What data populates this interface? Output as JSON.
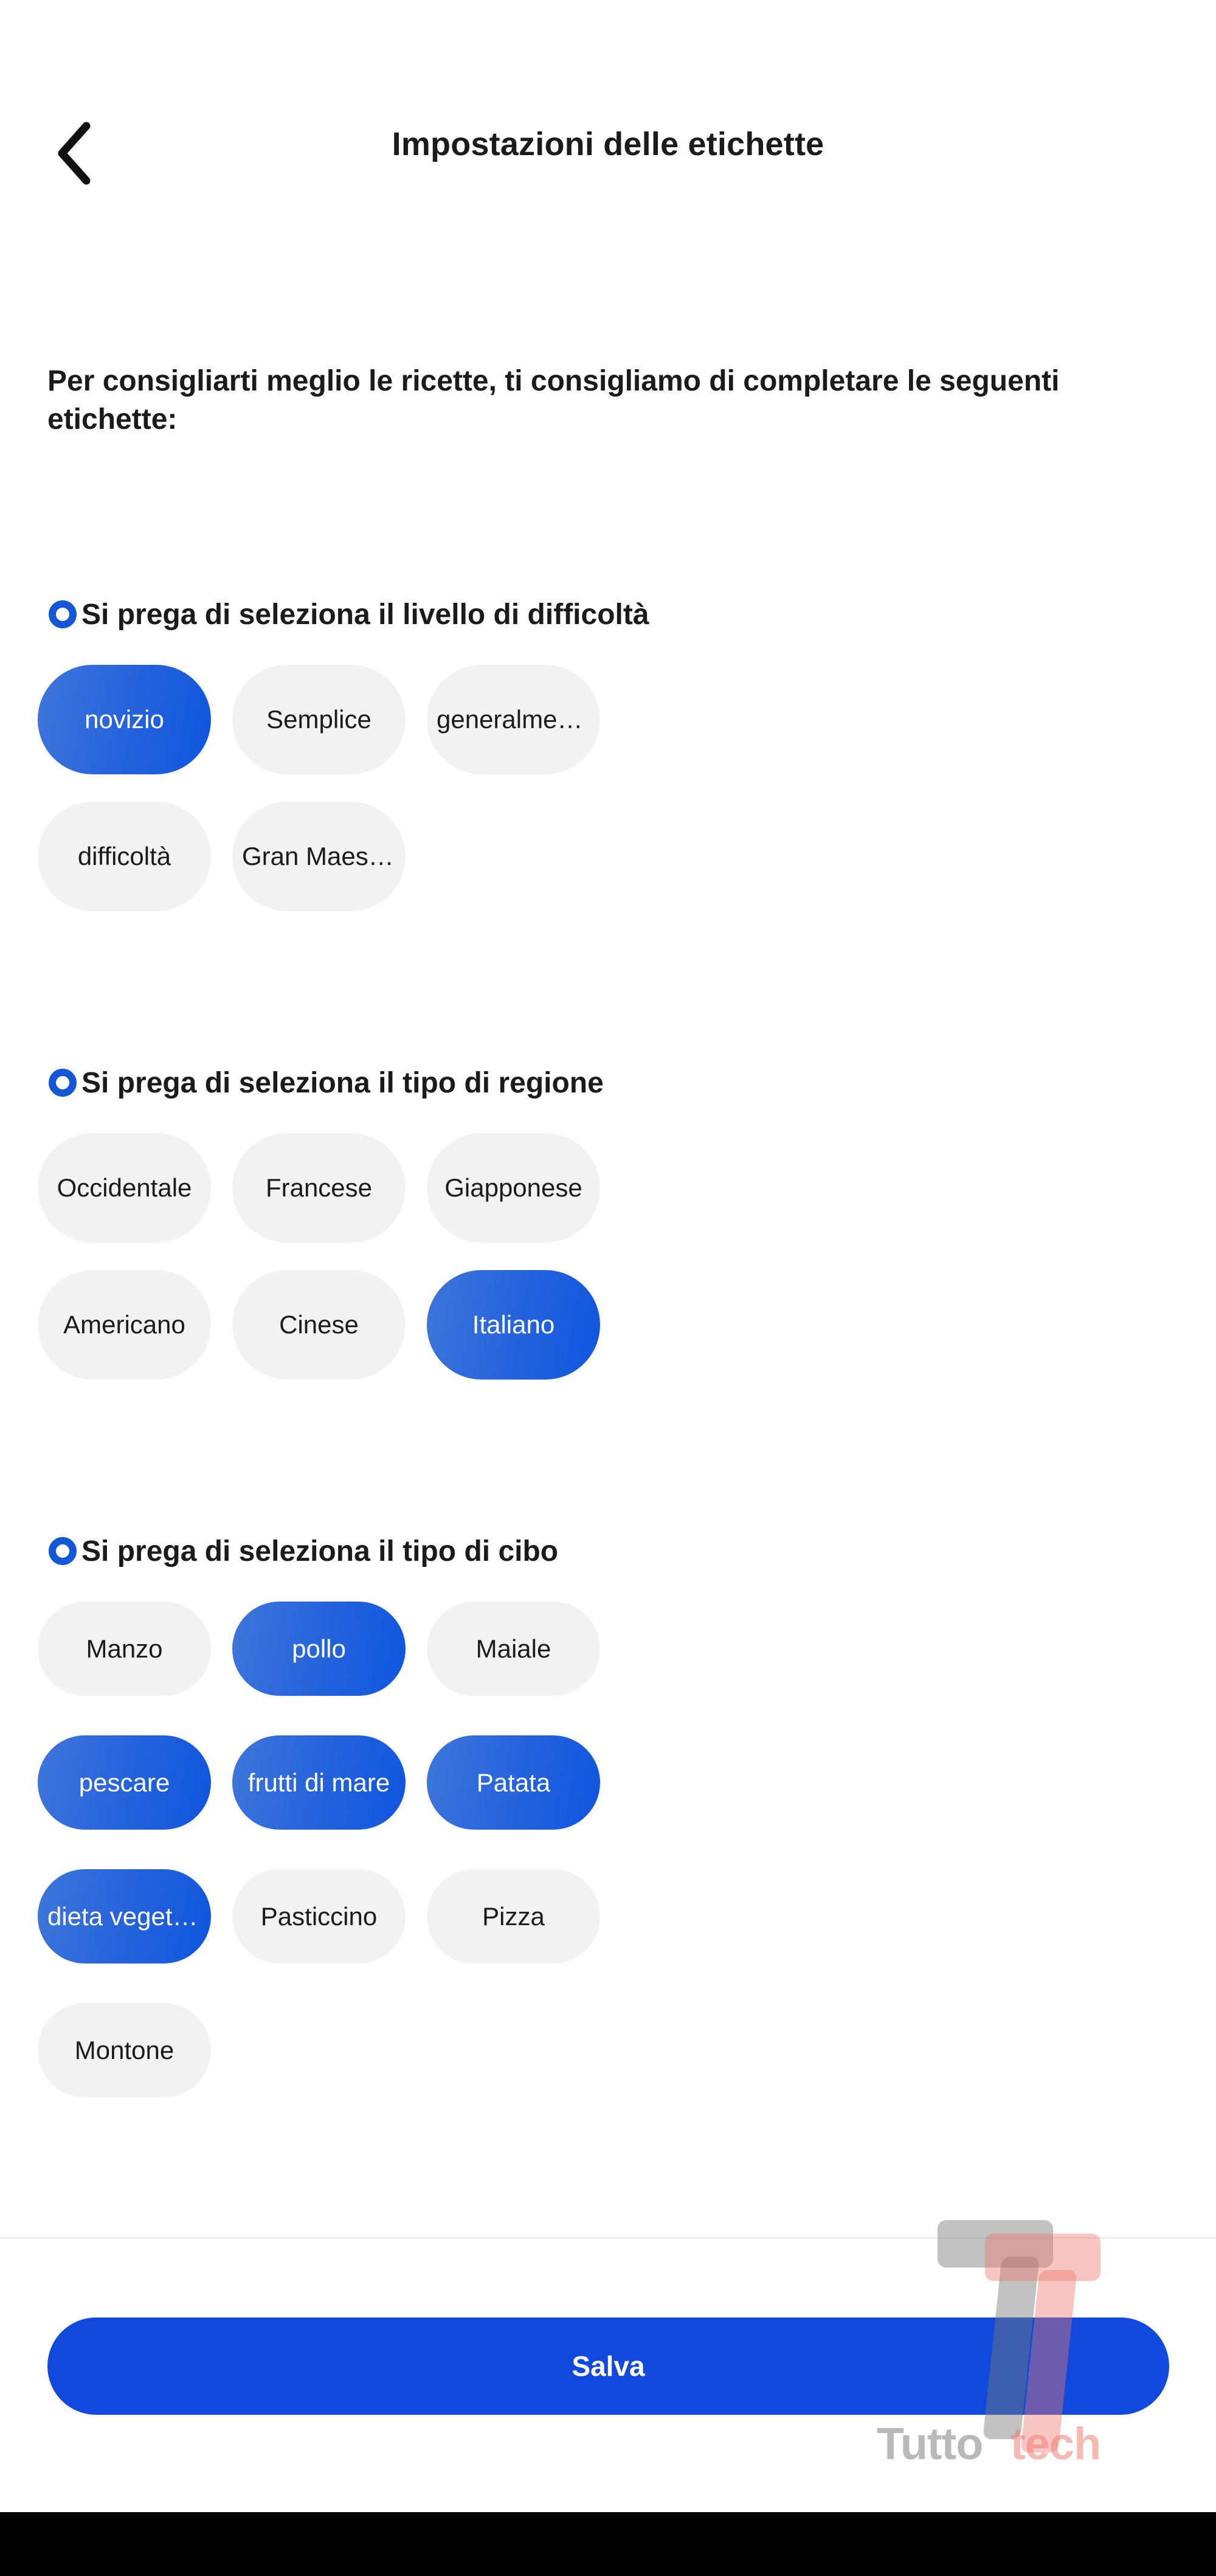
{
  "header": {
    "back_icon": "chevron-left-icon",
    "title": "Impostazioni delle etichette"
  },
  "intro": {
    "text": "Per consigliarti meglio le ricette, ti consigliamo di completare le seguenti etichette:"
  },
  "colors": {
    "accent_blue": "#1457d6",
    "selected_gradient_from": "#3e76d9",
    "selected_gradient_to": "#0f55de",
    "chip_unselected_bg": "#f2f2f2",
    "save_button_bg": "#1049db",
    "text_primary": "#1b1b1b",
    "divider": "#e7e7e7",
    "watermark_gray": "#787878",
    "watermark_pink": "#ee786e"
  },
  "sections": [
    {
      "id": "difficulty",
      "indicator": "radio-ring-icon",
      "title": "Si prega di seleziona il livello di difficoltà",
      "chips": [
        {
          "label": "novizio",
          "selected": true
        },
        {
          "label": "Semplice",
          "selected": false
        },
        {
          "label": "generalmente",
          "selected": false
        },
        {
          "label": "difficoltà",
          "selected": false
        },
        {
          "label": "Gran Maestro",
          "selected": false
        }
      ]
    },
    {
      "id": "region",
      "indicator": "radio-ring-icon",
      "title": "Si prega di seleziona il tipo di regione",
      "chips": [
        {
          "label": "Occidentale",
          "selected": false
        },
        {
          "label": "Francese",
          "selected": false
        },
        {
          "label": "Giapponese",
          "selected": false
        },
        {
          "label": "Americano",
          "selected": false
        },
        {
          "label": "Cinese",
          "selected": false
        },
        {
          "label": "Italiano",
          "selected": true
        }
      ]
    },
    {
      "id": "food",
      "indicator": "radio-ring-icon",
      "title": "Si prega di seleziona il tipo di cibo",
      "chips": [
        {
          "label": "Manzo",
          "selected": false
        },
        {
          "label": "pollo",
          "selected": true
        },
        {
          "label": "Maiale",
          "selected": false
        },
        {
          "label": "pescare",
          "selected": true
        },
        {
          "label": "frutti di mare",
          "selected": true
        },
        {
          "label": "Patata",
          "selected": true
        },
        {
          "label": "dieta vegetaria...",
          "selected": true
        },
        {
          "label": "Pasticcino",
          "selected": false
        },
        {
          "label": "Pizza",
          "selected": false
        },
        {
          "label": "Montone",
          "selected": false
        }
      ]
    }
  ],
  "footer": {
    "save_label": "Salva"
  },
  "watermark": {
    "word_one": "Tutto",
    "word_two": "tech",
    "logo": "double-t-logo"
  }
}
